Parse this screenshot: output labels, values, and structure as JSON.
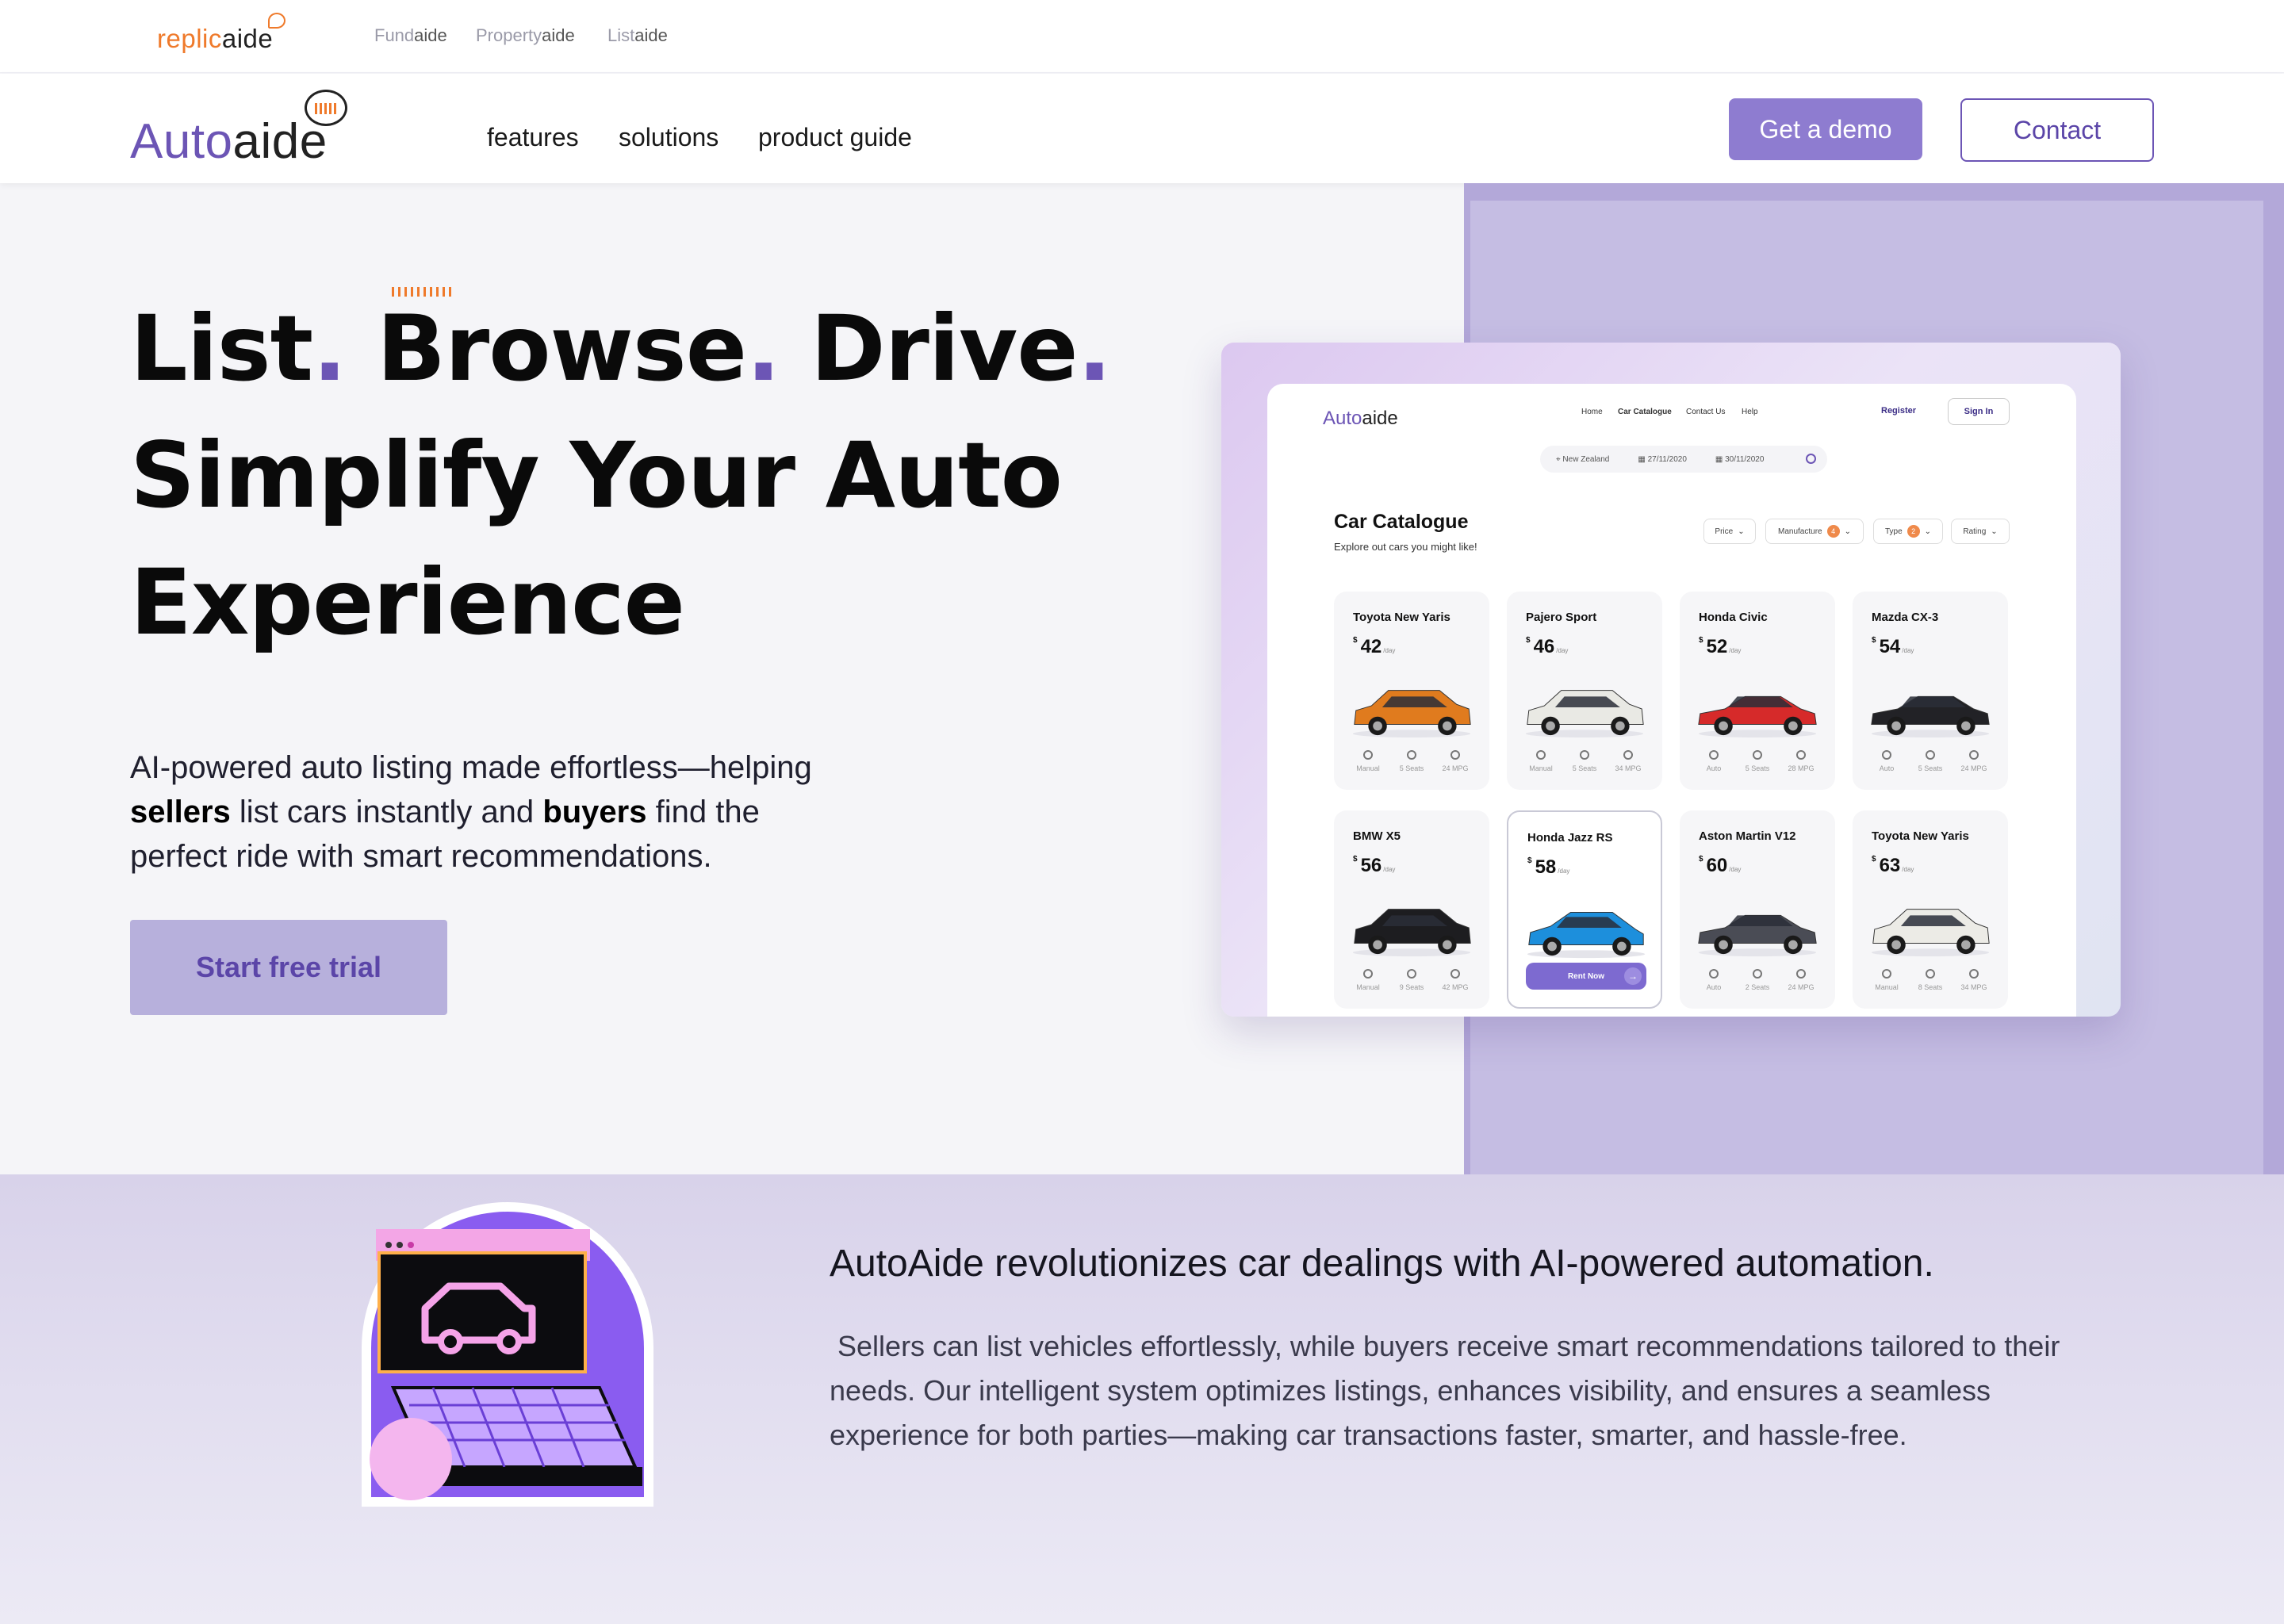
{
  "brandbar": {
    "main": {
      "part1": "replic",
      "part2": "aide"
    },
    "sub_brands": [
      {
        "part1": "Fund",
        "part2": "aide"
      },
      {
        "part1": "Property",
        "part2": "aide"
      },
      {
        "part1": "List",
        "part2": "aide"
      }
    ]
  },
  "nav": {
    "logo": {
      "part1": "Auto",
      "part2": "aide"
    },
    "links": [
      "features",
      "solutions",
      "product guide"
    ],
    "demo_label": "Get a demo",
    "contact_label": "Contact"
  },
  "hero": {
    "line1": {
      "w1": "List",
      "w2": "Browse",
      "w3": "Drive",
      "dot": "."
    },
    "line2": "Simplify Your Auto",
    "line3": "Experience",
    "text": {
      "t1": "AI-powered auto listing made effortless—helping",
      "b1": "sellers",
      "t2": "list cars instantly and",
      "b2": "buyers",
      "t3": "find the perfect ride with smart recommendations."
    },
    "cta_label": "Start free trial"
  },
  "mockup": {
    "logo": {
      "part1": "Auto",
      "part2": "aide"
    },
    "nav": [
      "Home",
      "Car Catalogue",
      "Contact Us",
      "Help"
    ],
    "register": "Register",
    "signin": "Sign In",
    "search": {
      "location": "New Zealand",
      "from": "27/11/2020",
      "to": "30/11/2020"
    },
    "title": "Car Catalogue",
    "subtitle": "Explore out cars you might like!",
    "filters": [
      {
        "label": "Price",
        "badge": ""
      },
      {
        "label": "Manufacture",
        "badge": "4"
      },
      {
        "label": "Type",
        "badge": "2"
      },
      {
        "label": "Rating",
        "badge": ""
      }
    ],
    "currency": "$",
    "per": "/day",
    "rent_label": "Rent Now",
    "cars": [
      {
        "name": "Toyota New Yaris",
        "price": "42",
        "color": "#e07b1e",
        "type": "suv",
        "specs": [
          "Manual",
          "5 Seats",
          "24 MPG"
        ]
      },
      {
        "name": "Pajero Sport",
        "price": "46",
        "color": "#e9e9e4",
        "type": "suv",
        "specs": [
          "Manual",
          "5 Seats",
          "34 MPG"
        ]
      },
      {
        "name": "Honda Civic",
        "price": "52",
        "color": "#d62a2a",
        "type": "sedan",
        "specs": [
          "Auto",
          "5 Seats",
          "28 MPG"
        ]
      },
      {
        "name": "Mazda CX-3",
        "price": "54",
        "color": "#222226",
        "type": "sedan",
        "specs": [
          "Auto",
          "5 Seats",
          "24 MPG"
        ]
      },
      {
        "name": "BMW X5",
        "price": "56",
        "color": "#1d1d20",
        "type": "suv",
        "specs": [
          "Manual",
          "9 Seats",
          "42 MPG"
        ]
      },
      {
        "name": "Honda Jazz RS",
        "price": "58",
        "color": "#1d8fdc",
        "type": "hatch",
        "specs": [],
        "selected": true
      },
      {
        "name": "Aston Martin V12",
        "price": "60",
        "color": "#4a4c55",
        "type": "sedan",
        "specs": [
          "Auto",
          "2 Seats",
          "24 MPG"
        ]
      },
      {
        "name": "Toyota New Yaris",
        "price": "63",
        "color": "#ecebe6",
        "type": "suv",
        "specs": [
          "Manual",
          "8 Seats",
          "34 MPG"
        ]
      }
    ]
  },
  "lower": {
    "title": "AutoAide revolutionizes car dealings with AI-powered automation.",
    "body": " Sellers can list vehicles effortlessly, while buyers receive smart recommendations tailored to their needs. Our intelligent system optimizes listings, enhances visibility, and ensures a seamless experience for both parties—making car transactions faster, smarter, and hassle-free."
  },
  "colors": {
    "accent": "#6c55b5",
    "orange": "#ef7a2b",
    "demo_bg": "#8e7cd0",
    "trial_bg": "#b7b0dc"
  },
  "icons": [
    "wave-icon",
    "location-icon",
    "calendar-icon",
    "search-icon",
    "chevron-down-icon",
    "steering-wheel-icon",
    "seat-icon",
    "fuel-icon",
    "arrow-right-icon"
  ]
}
